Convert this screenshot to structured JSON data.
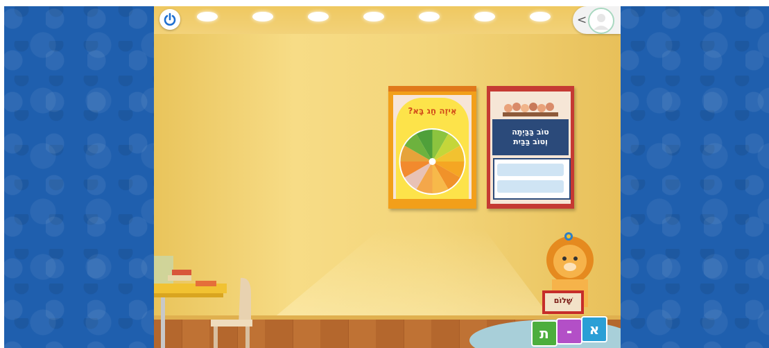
{
  "topbar": {
    "power_icon": "power-icon",
    "lights_count": 7,
    "profile_icon": "user-avatar-icon",
    "collapse_icon": "chevron-left-icon"
  },
  "posters": [
    {
      "id": "holiday",
      "title": "אֵיזֶה חַג בָּא?"
    },
    {
      "id": "family",
      "title_line1": "טוֹב בַּבַּיְתָה",
      "title_line2": "וְטוֹב בַּבַּיִת"
    }
  ],
  "mascot": {
    "book_label": "שָׁלוֹם",
    "blocks": [
      "ת",
      "-",
      "א"
    ]
  },
  "colors": {
    "background_blue": "#1f5fae",
    "wall": "#f3d57a",
    "holiday_poster": "#f29f1a",
    "family_poster": "#c53a33"
  }
}
